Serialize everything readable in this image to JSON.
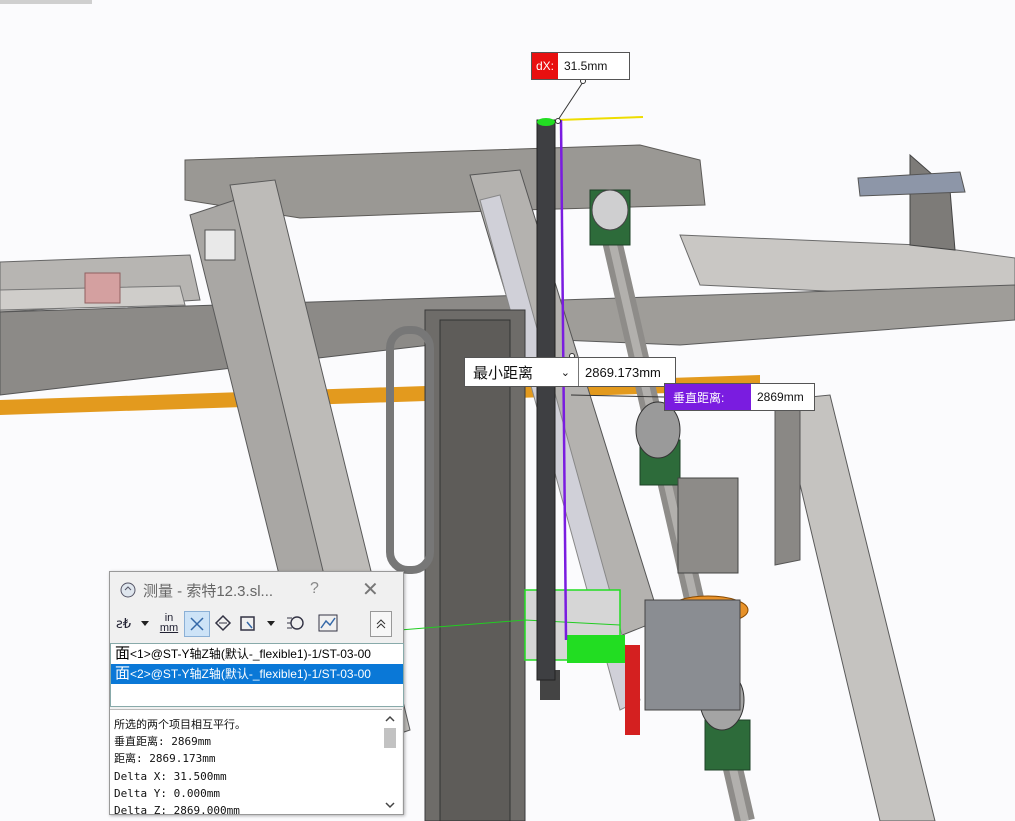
{
  "callouts": {
    "dx": {
      "tag": "dX:",
      "value": "31.5mm"
    },
    "min_distance": {
      "mode": "最小距离",
      "value": "2869.173mm"
    },
    "perpendicular": {
      "tag": "垂直距离:",
      "value": "2869mm"
    }
  },
  "measure_dialog": {
    "title": "测量 - 索特12.3.sl...",
    "help": "?",
    "toolbar": {
      "units_label_top": "in",
      "units_label_bottom": "mm"
    },
    "selections": [
      {
        "prefix": "面",
        "text": "<1>@ST-Y轴Z轴(默认-_flexible1)-1/ST-03-00"
      },
      {
        "prefix": "面",
        "text": "<2>@ST-Y轴Z轴(默认-_flexible1)-1/ST-03-00"
      }
    ],
    "results": [
      "所选的两个项目相互平行。",
      "垂直距离: 2869mm",
      "距离: 2869.173mm",
      "Delta X: 31.500mm",
      "Delta Y: 0.000mm",
      "Delta Z: 2869.000mm"
    ]
  },
  "colors": {
    "dx_tag": "#e81010",
    "perp_tag": "#7a1ce0",
    "selection": "#0a78d7",
    "measure_line": "#7a1ce0",
    "highlight_green": "#22dd22"
  }
}
